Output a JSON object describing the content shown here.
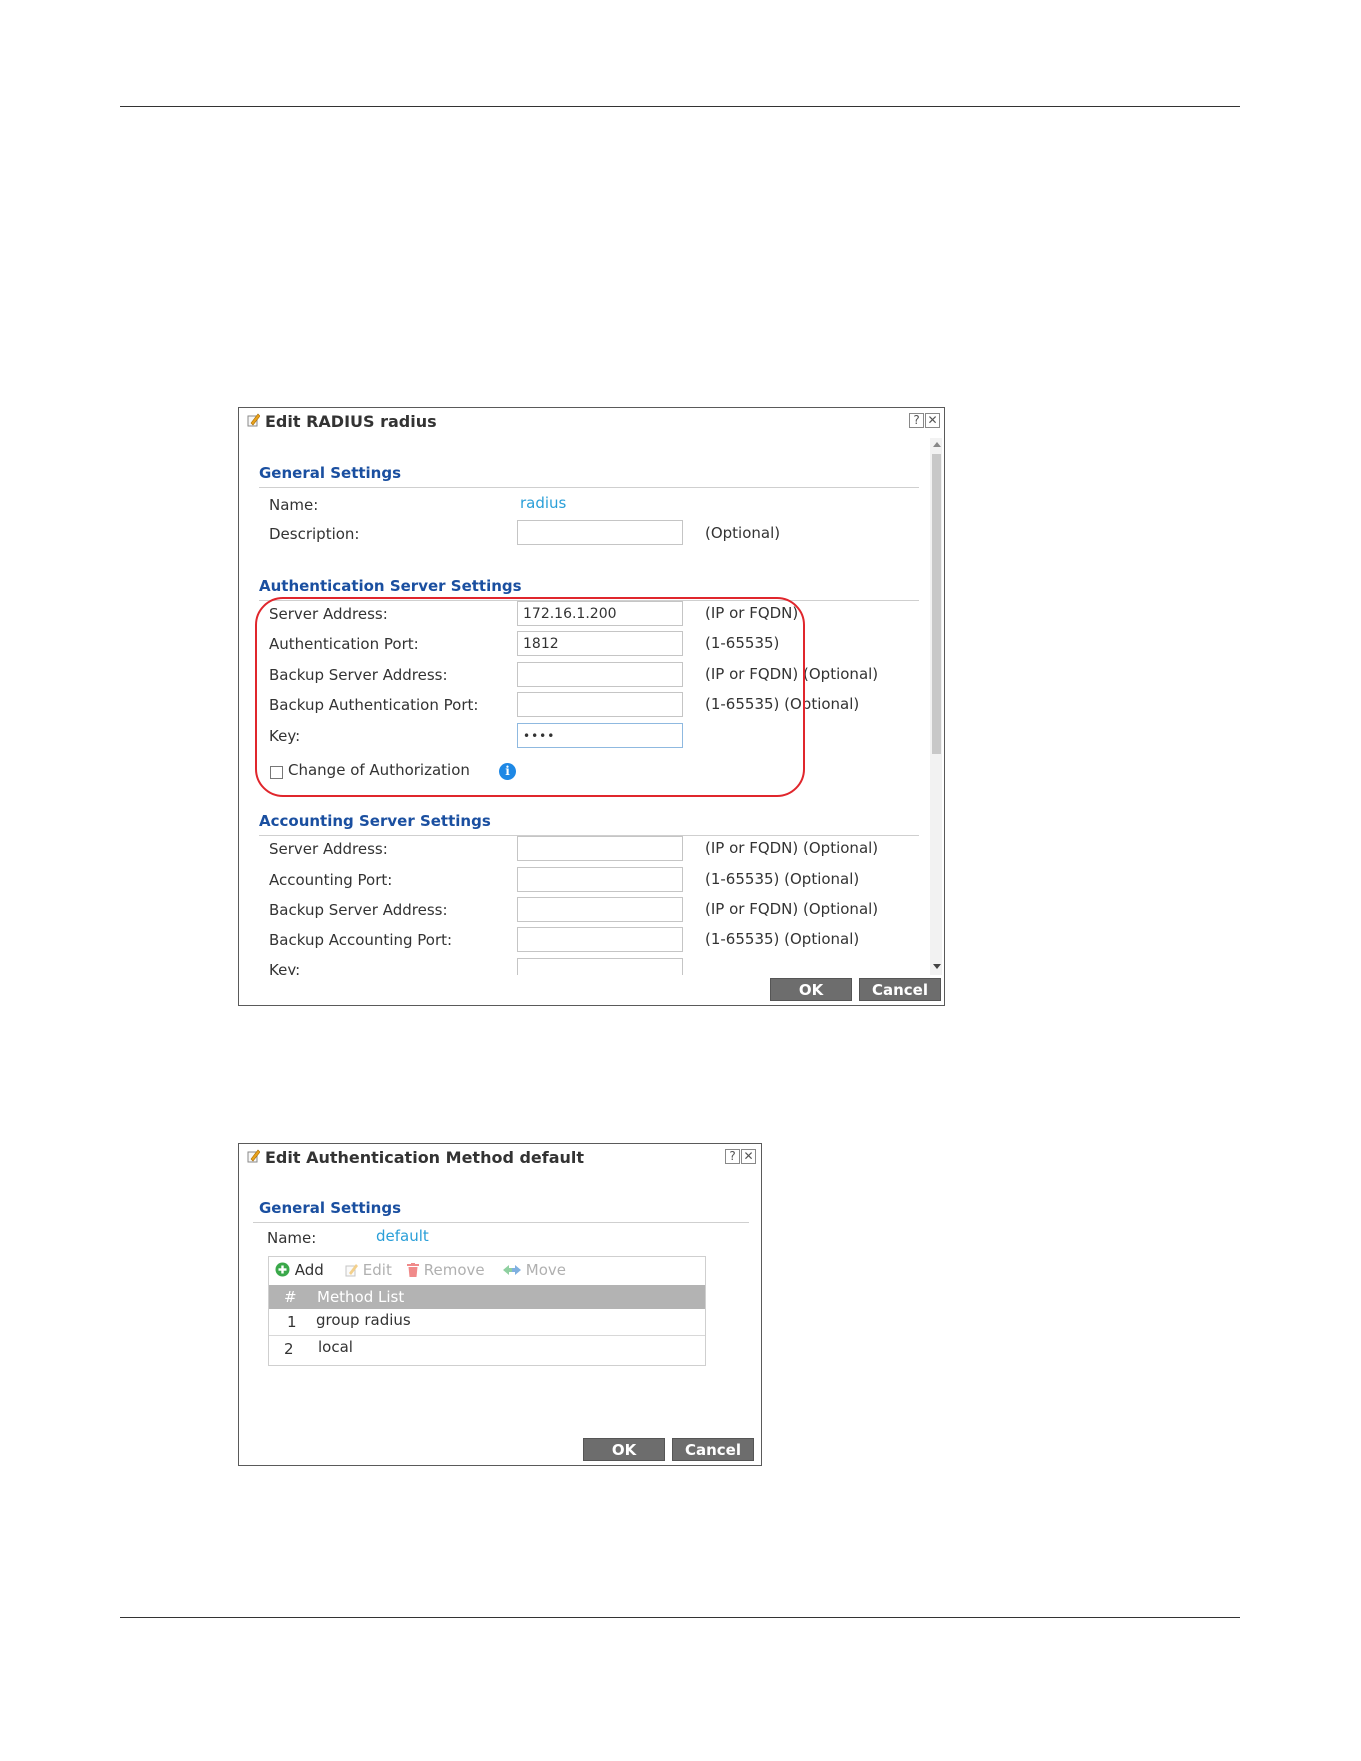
{
  "radius_dialog": {
    "title": "Edit RADIUS radius",
    "help_label": "?",
    "close_label": "✕",
    "general": {
      "section_title": "General Settings",
      "name_label": "Name:",
      "name_value": "radius",
      "description_label": "Description:",
      "description_value": "",
      "description_hint": "(Optional)"
    },
    "auth": {
      "section_title": "Authentication Server Settings",
      "server_address_label": "Server Address:",
      "server_address_value": "172.16.1.200",
      "server_address_hint": "(IP or FQDN)",
      "auth_port_label": "Authentication Port:",
      "auth_port_value": "1812",
      "auth_port_hint": "(1-65535)",
      "backup_server_label": "Backup Server Address:",
      "backup_server_value": "",
      "backup_server_hint": "(IP or FQDN) (Optional)",
      "backup_port_label": "Backup Authentication Port:",
      "backup_port_value": "",
      "backup_port_hint": "(1-65535) (Optional)",
      "key_label": "Key:",
      "key_value": "••••",
      "coa_label": "Change of Authorization",
      "coa_checked": false
    },
    "accounting": {
      "section_title": "Accounting Server Settings",
      "server_address_label": "Server Address:",
      "server_address_value": "",
      "server_address_hint": "(IP or FQDN) (Optional)",
      "port_label": "Accounting Port:",
      "port_value": "",
      "port_hint": "(1-65535) (Optional)",
      "backup_server_label": "Backup Server Address:",
      "backup_server_value": "",
      "backup_server_hint": "(IP or FQDN) (Optional)",
      "backup_port_label": "Backup Accounting Port:",
      "backup_port_value": "",
      "backup_port_hint": "(1-65535) (Optional)",
      "key_label": "Key:"
    },
    "ok_label": "OK",
    "cancel_label": "Cancel"
  },
  "method_dialog": {
    "title": "Edit Authentication Method default",
    "help_label": "?",
    "close_label": "✕",
    "section_title": "General Settings",
    "name_label": "Name:",
    "name_value": "default",
    "toolbar": {
      "add_label": "Add",
      "edit_label": "Edit",
      "remove_label": "Remove",
      "move_label": "Move"
    },
    "table": {
      "col_index": "#",
      "col_method": "Method List",
      "rows": [
        {
          "index": "1",
          "method": "group radius"
        },
        {
          "index": "2",
          "method": "local"
        }
      ]
    },
    "ok_label": "OK",
    "cancel_label": "Cancel"
  },
  "colors": {
    "section_title": "#1a4fa0",
    "link_value": "#2a9fd8",
    "highlight_ring": "#e0262c",
    "button_bg": "#6d6d6d",
    "grid_header_bg": "#b3b3b3"
  }
}
